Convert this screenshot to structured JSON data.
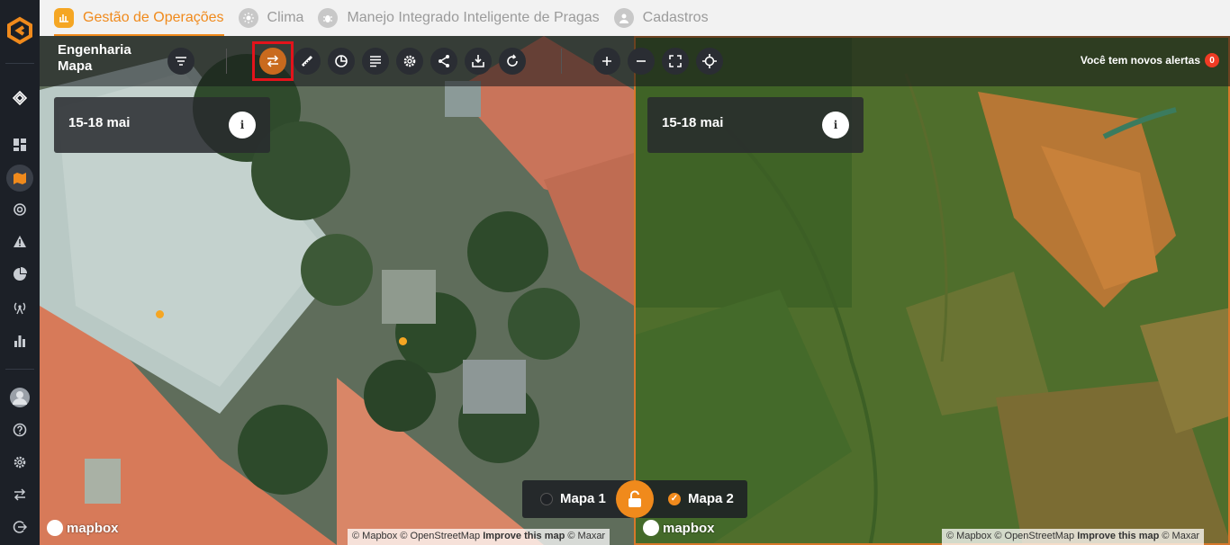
{
  "topnav": {
    "tabs": [
      {
        "label": "Gestão de Operações",
        "active": true
      },
      {
        "label": "Clima",
        "active": false
      },
      {
        "label": "Manejo Integrado Inteligente de Pragas",
        "active": false
      },
      {
        "label": "Cadastros",
        "active": false
      }
    ]
  },
  "project": {
    "line1": "Engenharia",
    "line2": "Mapa"
  },
  "alerts": {
    "text": "Você tem novos alertas",
    "count": "0"
  },
  "map_left": {
    "date": "15-18 mai",
    "info": "i"
  },
  "map_right": {
    "date": "15-18 mai",
    "info": "i"
  },
  "compare": {
    "map1": "Mapa 1",
    "map2": "Mapa 2",
    "map1_selected": false,
    "map2_selected": true
  },
  "attribution": {
    "mapbox_logo": "mapbox",
    "text": "© Mapbox © OpenStreetMap",
    "improve": "Improve this map",
    "maxar": "© Maxar"
  },
  "colors": {
    "accent": "#f08a1c",
    "highlight": "#e3131b",
    "rail_bg": "#1c2027"
  }
}
